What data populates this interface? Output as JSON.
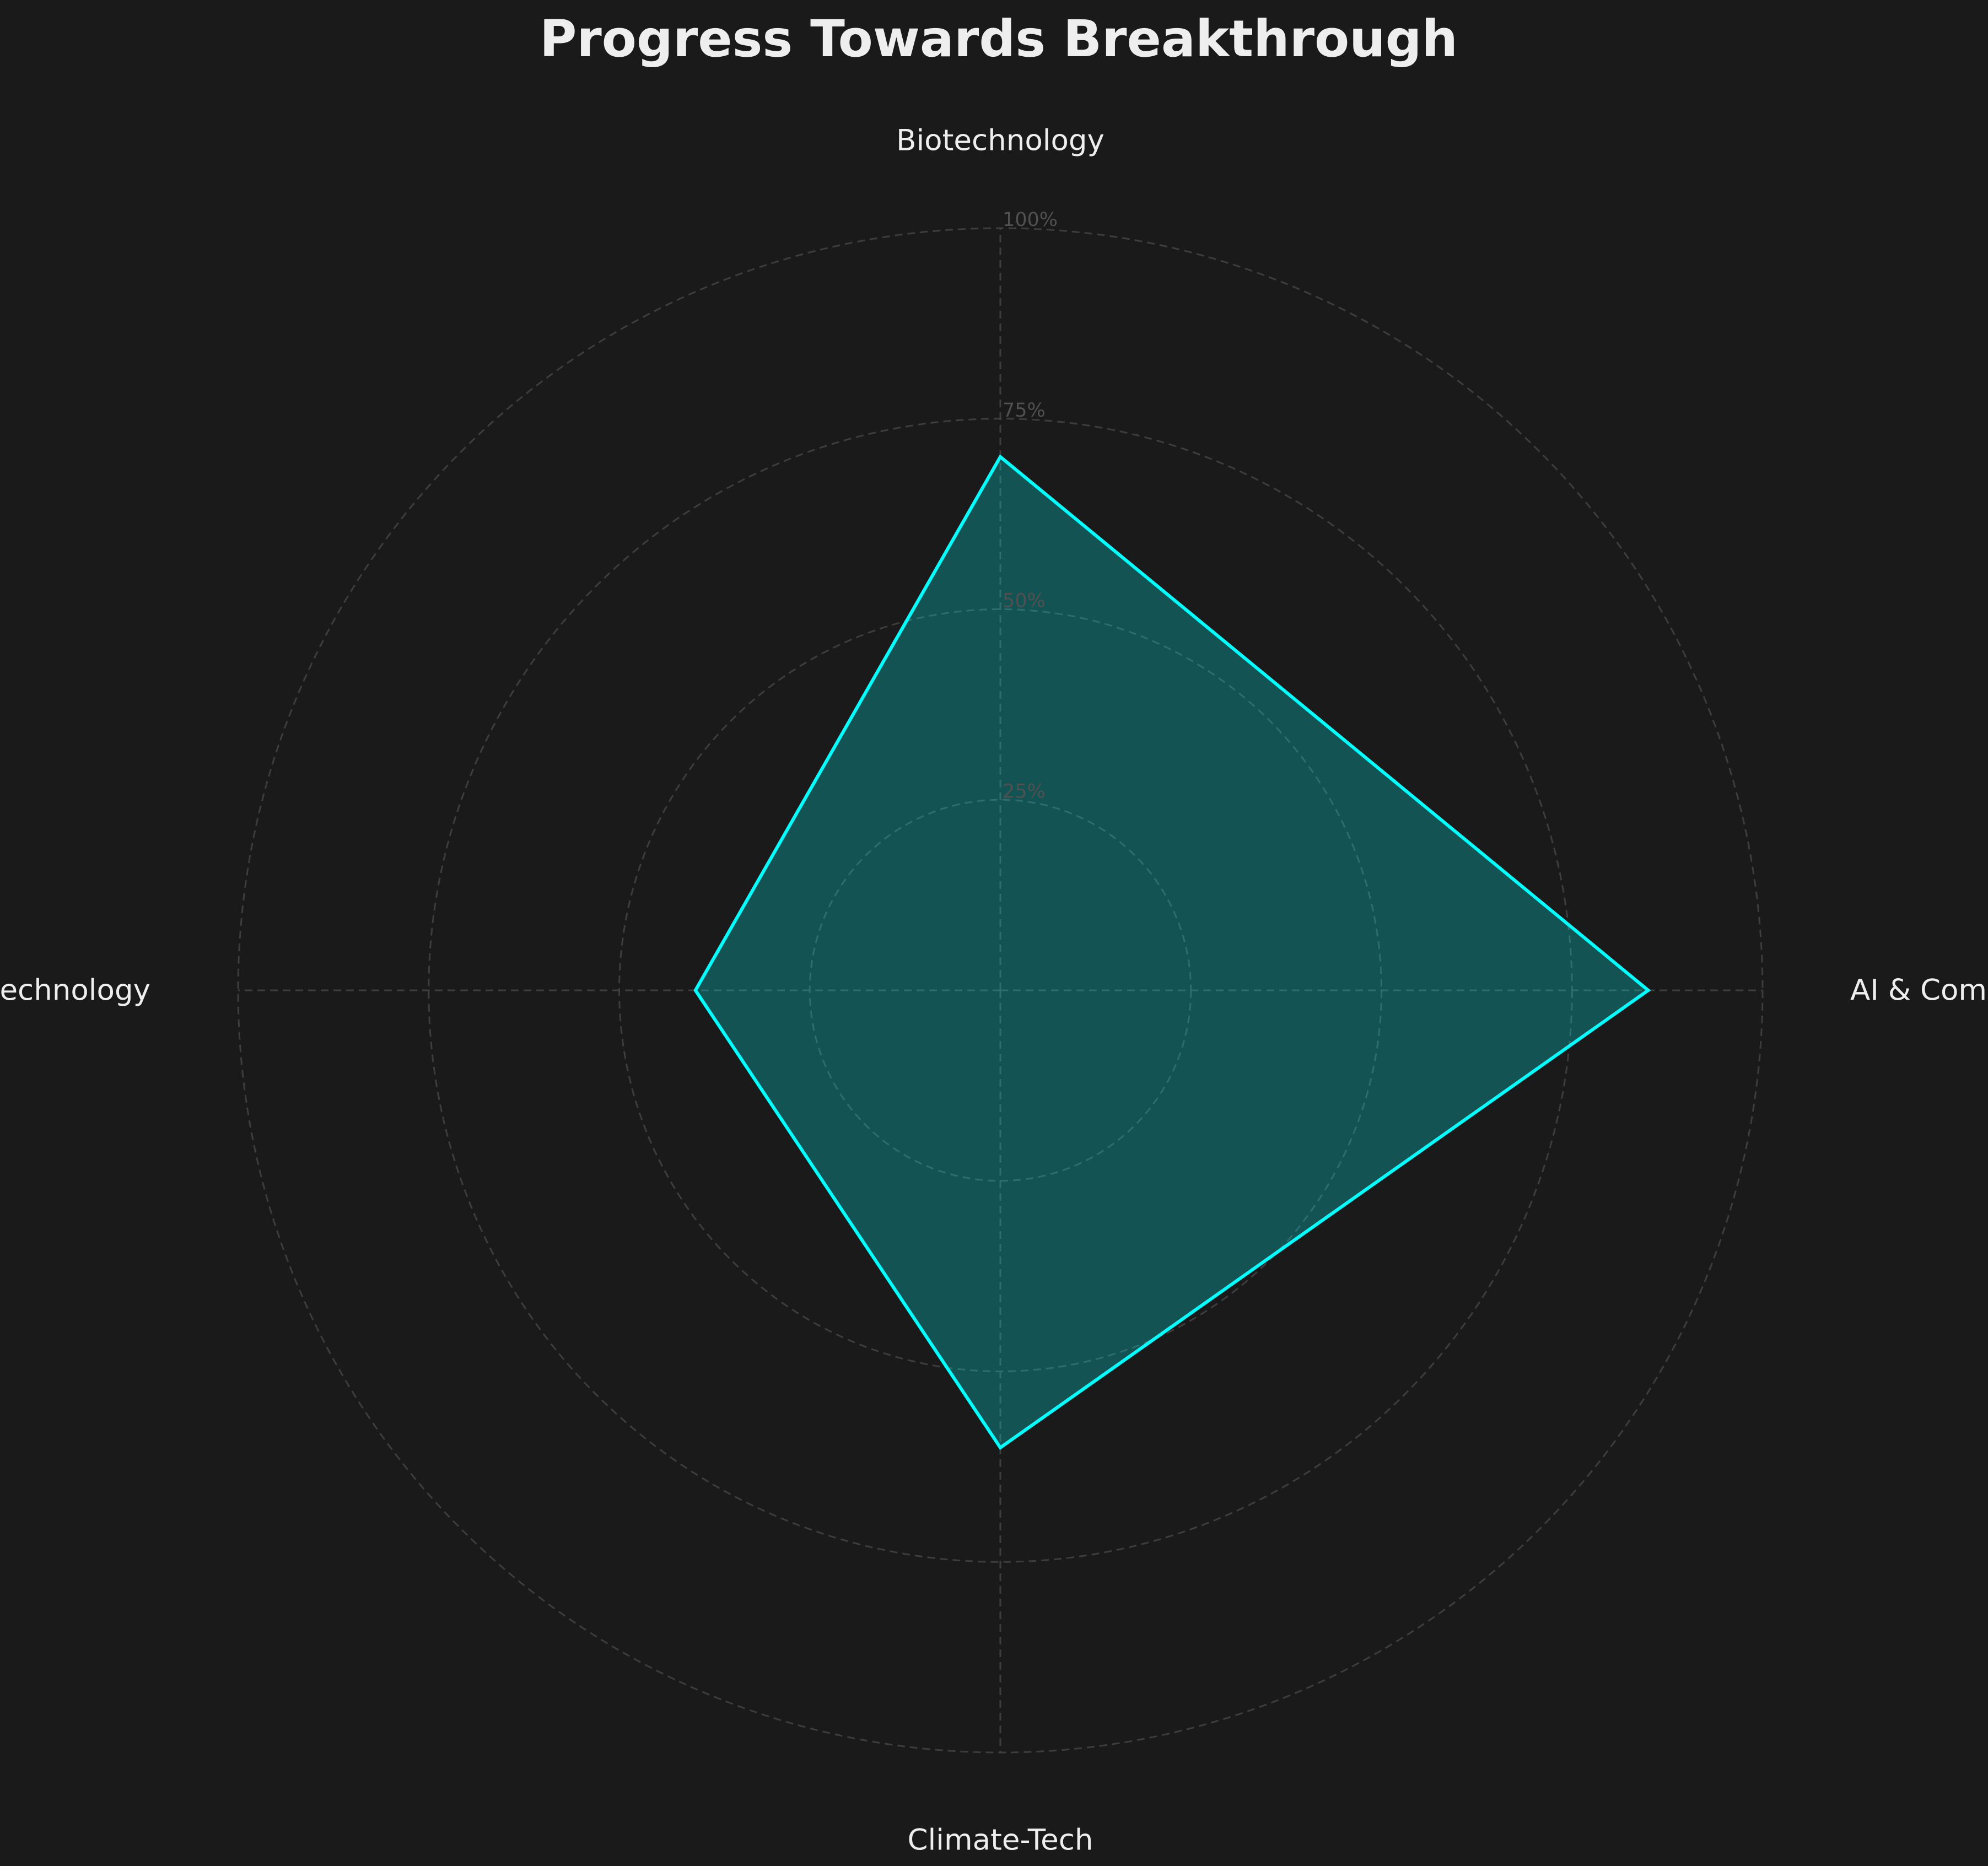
{
  "chart_data": {
    "type": "radar",
    "title": "Progress Towards Breakthrough",
    "categories": [
      "AI & Computing",
      "Biotechnology",
      "Neurotechnology",
      "Climate-Tech"
    ],
    "series": [
      {
        "values": [
          85,
          70,
          40,
          60
        ]
      }
    ],
    "rlim": [
      0,
      100
    ],
    "radial_ticks": [
      "25%",
      "50%",
      "75%",
      "100%"
    ],
    "radial_tick_values": [
      25,
      50,
      75,
      100
    ],
    "grid": true,
    "colors": {
      "background": "#1a1a1a",
      "line": "#00ffff",
      "fill": "#00ffff",
      "grid": "#444444",
      "text": "#eeeeee",
      "tick_text": "#505050"
    }
  }
}
